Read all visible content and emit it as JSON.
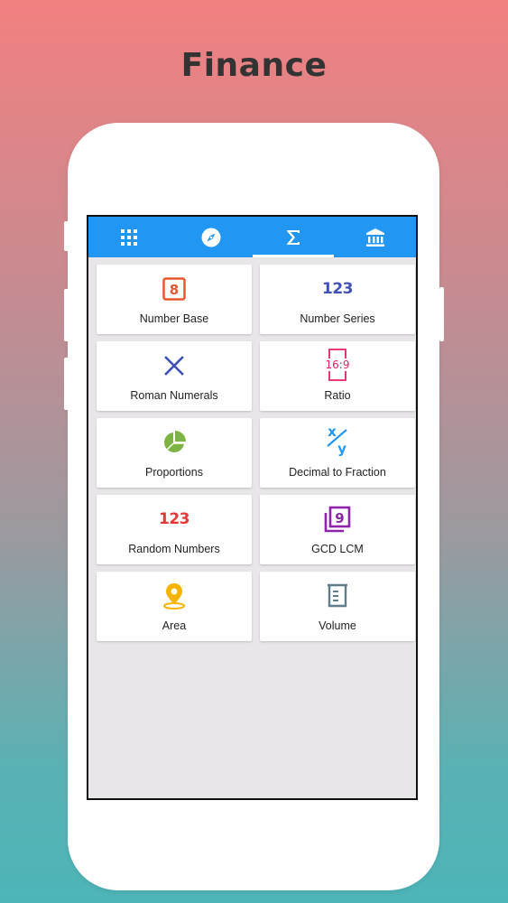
{
  "headline": "Finance",
  "tabs": [
    {
      "icon": "grid-icon",
      "active": false
    },
    {
      "icon": "compass-icon",
      "active": false
    },
    {
      "icon": "sigma-icon",
      "active": true
    },
    {
      "icon": "bank-icon",
      "active": false
    }
  ],
  "cards": [
    {
      "label": "Number Base",
      "icon": "number-base-icon",
      "icon_text": "8",
      "color": "#e8572e"
    },
    {
      "label": "Number Series",
      "icon": "number-series-icon",
      "icon_text": "123",
      "color": "#3f51b5"
    },
    {
      "label": "Roman Numerals",
      "icon": "roman-numerals-icon",
      "color": "#3f51b5"
    },
    {
      "label": "Ratio",
      "icon": "ratio-icon",
      "icon_text": "16:9",
      "color": "#e91e63"
    },
    {
      "label": "Proportions",
      "icon": "pie-chart-icon",
      "color": "#7cb342"
    },
    {
      "label": "Decimal to Fraction",
      "icon": "fraction-icon",
      "icon_text_top": "x",
      "icon_text_bottom": "y",
      "color": "#2196f3"
    },
    {
      "label": "Random Numbers",
      "icon": "random-numbers-icon",
      "icon_text": "123",
      "color": "#e53935"
    },
    {
      "label": "GCD LCM",
      "icon": "gcd-lcm-icon",
      "icon_text": "9",
      "color": "#8e24aa"
    },
    {
      "label": "Area",
      "icon": "location-pin-icon",
      "color": "#f4b400"
    },
    {
      "label": "Volume",
      "icon": "beaker-icon",
      "color": "#607d8b"
    }
  ]
}
